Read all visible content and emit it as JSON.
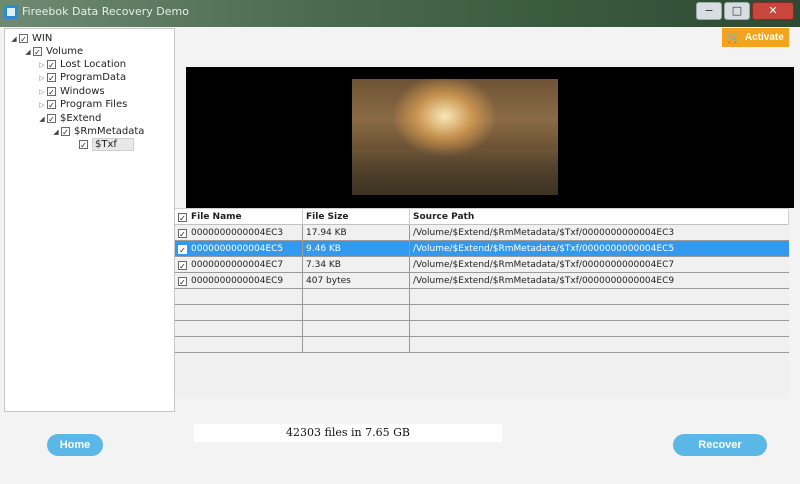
{
  "window": {
    "title": "Fireebok Data Recovery Demo",
    "minimize": "−",
    "maximize": "□",
    "close": "✕"
  },
  "tree": [
    {
      "label": "WIN",
      "expanded": true,
      "checked": true
    },
    {
      "label": "Volume",
      "expanded": true,
      "checked": true
    },
    {
      "label": "Lost Location",
      "expanded": false,
      "checked": true
    },
    {
      "label": "ProgramData",
      "expanded": false,
      "checked": true
    },
    {
      "label": "Windows",
      "expanded": false,
      "checked": true
    },
    {
      "label": "Program Files",
      "expanded": false,
      "checked": true
    },
    {
      "label": "$Extend",
      "expanded": true,
      "checked": true
    },
    {
      "label": "$RmMetadata",
      "expanded": true,
      "checked": true
    },
    {
      "label": "$Txf",
      "expanded": false,
      "checked": true,
      "selected": true
    }
  ],
  "activate": {
    "label": "Activate",
    "icon": "cart-icon",
    "color": "#f4a21f"
  },
  "table": {
    "headers": [
      "File Name",
      "File Size",
      "Source Path"
    ],
    "rows": [
      {
        "name": "0000000000004EC3",
        "size": "17.94 KB",
        "path": "/Volume/$Extend/$RmMetadata/$Txf/0000000000004EC3",
        "checked": true
      },
      {
        "name": "0000000000004EC5",
        "size": "9.46 KB",
        "path": "/Volume/$Extend/$RmMetadata/$Txf/0000000000004EC5",
        "checked": true,
        "selected": true
      },
      {
        "name": "0000000000004EC7",
        "size": "7.34 KB",
        "path": "/Volume/$Extend/$RmMetadata/$Txf/0000000000004EC7",
        "checked": true
      },
      {
        "name": "0000000000004EC9",
        "size": "407 bytes",
        "path": "/Volume/$Extend/$RmMetadata/$Txf/0000000000004EC9",
        "checked": true
      }
    ],
    "selected_color": "#3399ee"
  },
  "status": "42303 files in 7.65 GB",
  "buttons": {
    "home": "Home",
    "recover": "Recover",
    "color": "#5bb8e6"
  }
}
